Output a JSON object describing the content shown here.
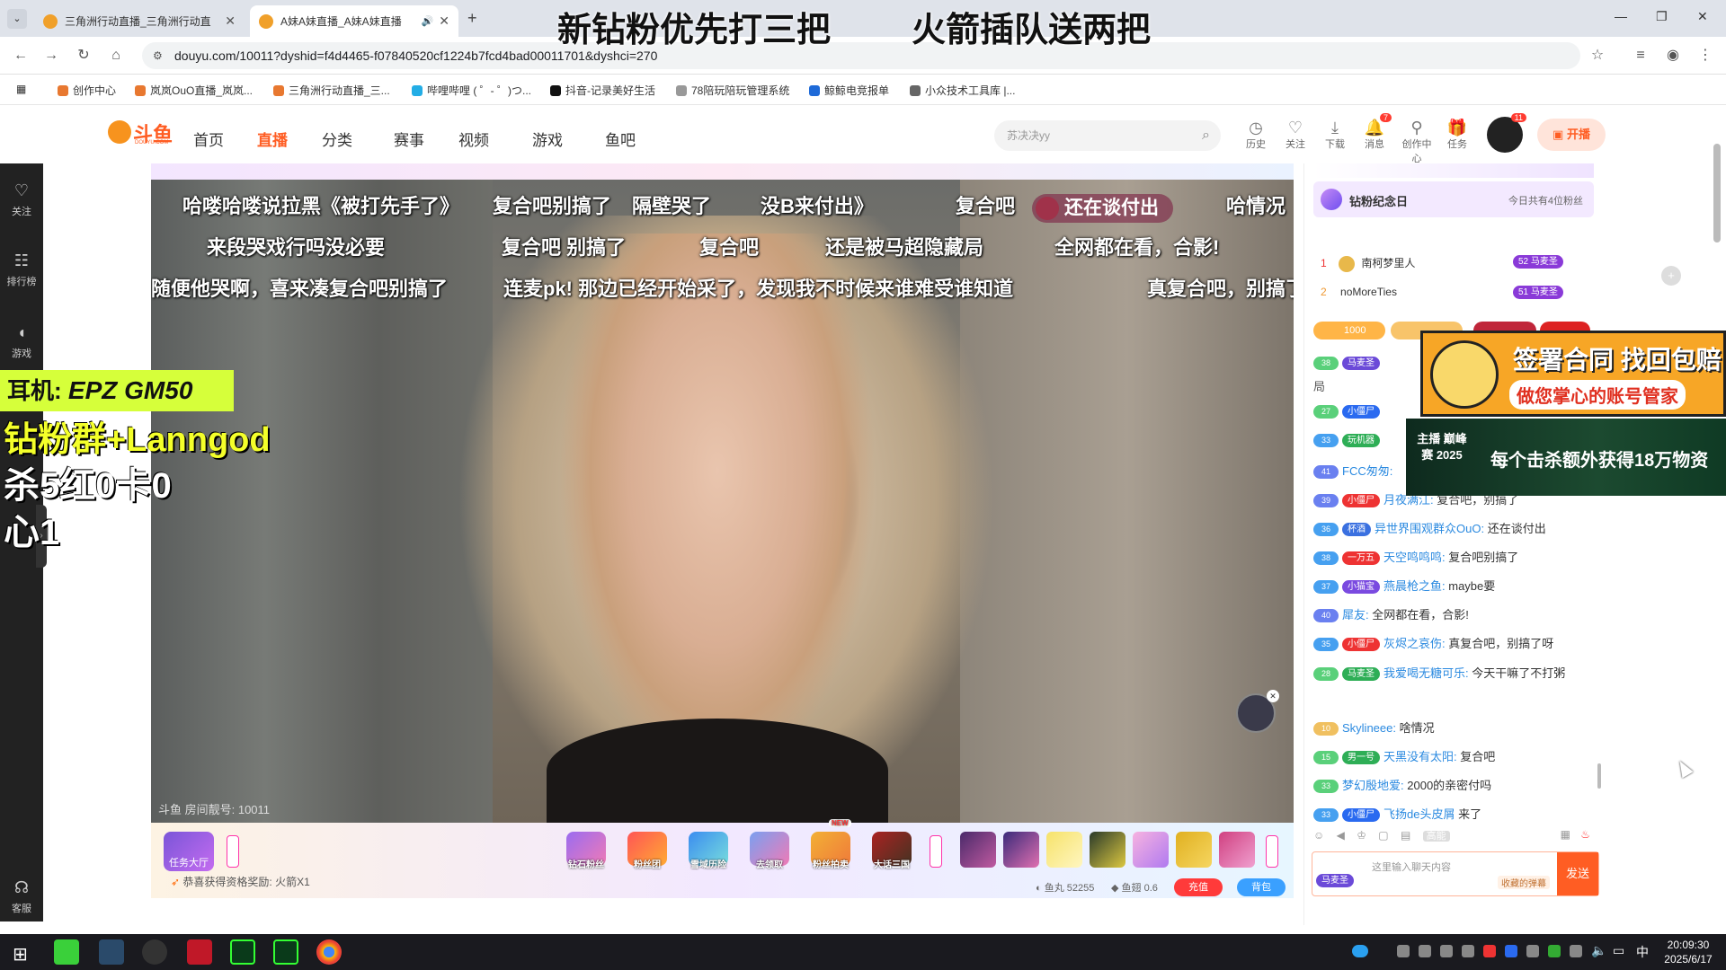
{
  "overlay": {
    "top_banner_left": "新钻粉优先打三把",
    "top_banner_right": "火箭插队送两把",
    "earphone_label": "耳机:",
    "earphone_model": "EPZ GM50",
    "fan_group": "钻粉群+Lanngod",
    "kills": "杀5红0卡0",
    "heart": "心1",
    "ad_contract_line1": "签署合同 找回包赔",
    "ad_contract_line2": "做您掌心的账号管家",
    "ad_bonus": "每个击杀额外获得18万物资",
    "ad_bonus_logo": "主播 巅峰赛 2025"
  },
  "browser": {
    "tabs": [
      {
        "label": "三角洲行动直播_三角洲行动直",
        "active": false
      },
      {
        "label": "A妹A妹直播_A妹A妹直播",
        "active": true
      }
    ],
    "url": "douyu.com/10011?dyshid=f4d4465-f07840520cf1224b7fcd4bad00011701&dyshci=270",
    "bookmarks": [
      "创作中心",
      "岚岚OuO直播_岚岚...",
      "三角洲行动直播_三...",
      "哔哩哔哩 ( ゜- ゜)つ...",
      "抖音-记录美好生活",
      "78陪玩陪玩管理系统",
      "鲸鲸电竞报单",
      "小众技术工具库 |..."
    ]
  },
  "site": {
    "logo": "斗鱼",
    "logo_sub": "DOUYU.COM",
    "nav": [
      "首页",
      "直播",
      "分类",
      "赛事",
      "视频",
      "游戏",
      "鱼吧"
    ],
    "search_placeholder": "苏决决yy",
    "header_icons": [
      {
        "name": "history",
        "label": "历史"
      },
      {
        "name": "follow",
        "label": "关注"
      },
      {
        "name": "download",
        "label": "下载"
      },
      {
        "name": "message",
        "label": "消息",
        "badge": "7"
      },
      {
        "name": "creator",
        "label": "创作中心"
      },
      {
        "name": "task",
        "label": "任务"
      }
    ],
    "avatar_badge": "11",
    "start_live": "开播"
  },
  "sidebar": [
    {
      "icon": "heart-icon",
      "label": "关注"
    },
    {
      "icon": "rank-icon",
      "label": "排行榜"
    },
    {
      "icon": "game-icon",
      "label": "游戏"
    },
    {
      "icon": "service-icon",
      "label": "客服"
    }
  ],
  "player": {
    "room_label": "斗鱼 房间靓号: 10011",
    "floating_tag": "还在谈付出",
    "danmu": [
      "哈喽哈喽说拉黑《被打先手了》",
      "复合吧别搞了",
      "隔壁哭了",
      "没B来付出》",
      "复合吧",
      "哈情况",
      "来段哭戏行吗没必要",
      "复合吧 别搞了",
      "复合吧",
      "还是被马超隐藏局",
      "全网都在看，合影!",
      "随便他哭啊，喜来凑复合吧别搞了",
      "连麦pk! 那边已经开始采了，发现我不时候来谁难受谁知道",
      "真复合吧，别搞了"
    ]
  },
  "giftbar": {
    "task_hall": "任务大厅",
    "gifts": [
      "钻石粉丝",
      "粉丝团",
      "雪域历险",
      "去领取",
      "粉丝拍卖",
      "大话三国"
    ],
    "new_badge": "NEW",
    "reward_text": "恭喜获得资格奖励: 火箭X1",
    "fish_pill_label": "鱼丸",
    "fish_pill_value": "52255",
    "fish_fin_label": "鱼翅",
    "fish_fin_value": "0.6",
    "recharge": "充值",
    "backpack": "背包"
  },
  "chat": {
    "fan_day_title": "钻粉纪念日",
    "fan_day_count": "今日共有4位粉丝",
    "ranks": [
      {
        "rank": "1",
        "name": "南柯梦里人",
        "level": "52",
        "tag": "马麦圣"
      },
      {
        "rank": "2",
        "name": "noMoreTies",
        "level": "51",
        "tag": "马麦圣"
      }
    ],
    "fish_count": "1000",
    "messages": [
      {
        "level": "38",
        "badge": "马麦圣",
        "nick": "",
        "text": "局"
      },
      {
        "level": "27",
        "badge": "小僵尸",
        "nick": "",
        "text": ""
      },
      {
        "level": "33",
        "badge": "玩机器",
        "nick": "",
        "text": ""
      },
      {
        "level": "41",
        "badge": "",
        "nick": "FCC匆匆:",
        "text": ""
      },
      {
        "level": "39",
        "badge": "小僵尸",
        "nick": "月夜满江:",
        "text": "复合吧，别搞了"
      },
      {
        "level": "36",
        "badge": "杯酒",
        "nick": "异世界围观群众OuO:",
        "text": "还在谈付出"
      },
      {
        "level": "38",
        "badge": "一万五",
        "nick": "天空鸣鸣鸣:",
        "text": "复合吧别搞了"
      },
      {
        "level": "37",
        "badge": "小猫宝",
        "nick": "燕晨枪之鱼:",
        "text": "maybe要"
      },
      {
        "level": "40",
        "badge": "",
        "nick": "犀友:",
        "text": "全网都在看，合影!"
      },
      {
        "level": "35",
        "badge": "小僵尸",
        "nick": "灰烬之哀伤:",
        "text": "真复合吧，别搞了呀"
      },
      {
        "level": "28",
        "badge": "马麦圣",
        "nick": "我爱喝无糖可乐:",
        "text": "今天干嘛了不打粥"
      },
      {
        "level": "10",
        "badge": "",
        "nick": "Skylineee:",
        "text": "啥情况"
      },
      {
        "level": "15",
        "badge": "男一号",
        "nick": "天黑没有太阳:",
        "text": "复合吧"
      },
      {
        "level": "33",
        "badge": "",
        "nick": "梦幻殷地爱:",
        "text": "2000的亲密付吗"
      },
      {
        "level": "33",
        "badge": "小僵尸",
        "nick": "飞扬de头皮屑",
        "text": "来了"
      }
    ],
    "tool_label": "高能",
    "input_placeholder": "这里输入聊天内容",
    "input_tag": "收藏的弹幕",
    "send": "发送",
    "user_badge": "马麦圣"
  },
  "taskbar": {
    "time": "20:09:30",
    "date": "2025/6/17",
    "ime": "中"
  }
}
